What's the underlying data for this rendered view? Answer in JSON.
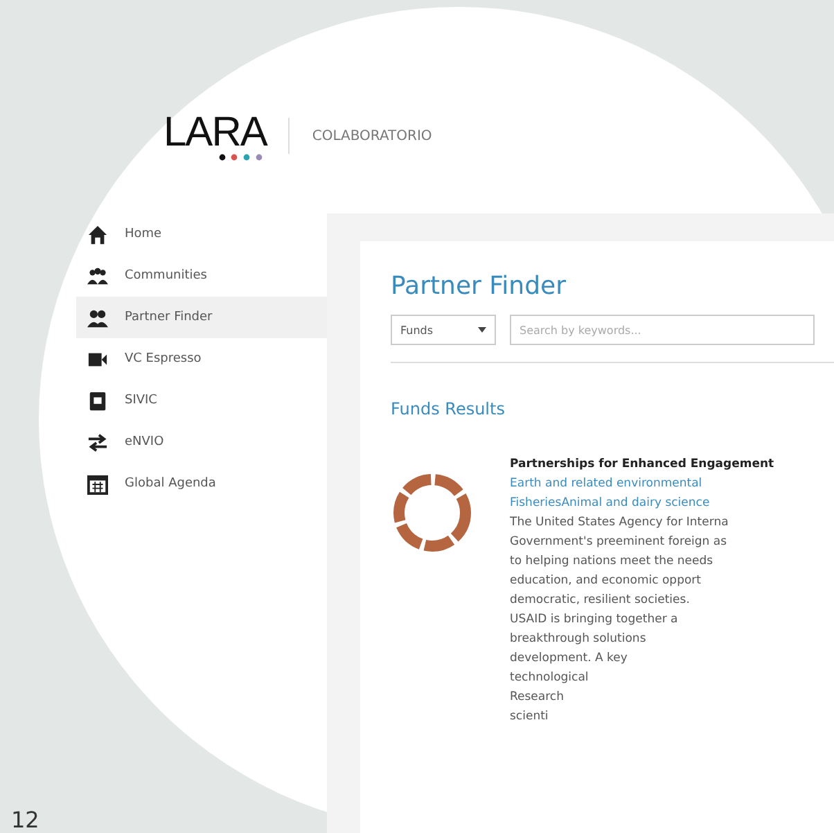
{
  "header": {
    "logo": "LARA",
    "site": "COLABORATORIO"
  },
  "sidebar": {
    "items": [
      {
        "label": "Home",
        "selected": false
      },
      {
        "label": "Communities",
        "selected": false
      },
      {
        "label": "Partner Finder",
        "selected": true
      },
      {
        "label": "VC Espresso",
        "selected": false
      },
      {
        "label": "SIVIC",
        "selected": false
      },
      {
        "label": "eNVIO",
        "selected": false
      },
      {
        "label": "Global Agenda",
        "selected": false
      }
    ]
  },
  "main": {
    "title": "Partner Finder",
    "filter": {
      "value": "Funds"
    },
    "search": {
      "placeholder": "Search by keywords..."
    },
    "results_title": "Funds Results",
    "result": {
      "title": "Partnerships for Enhanced Engagement",
      "tags": [
        "Earth and related environmental",
        "FisheriesAnimal and dairy science"
      ],
      "lines": [
        "The United States Agency for Interna",
        "Government's preeminent foreign as",
        "to helping nations meet the needs",
        "education, and economic opport",
        "democratic, resilient societies.",
        "USAID is bringing together a",
        "breakthrough solutions",
        "development. A key",
        "technological",
        "Research",
        "scienti"
      ]
    }
  },
  "page_number": "12"
}
